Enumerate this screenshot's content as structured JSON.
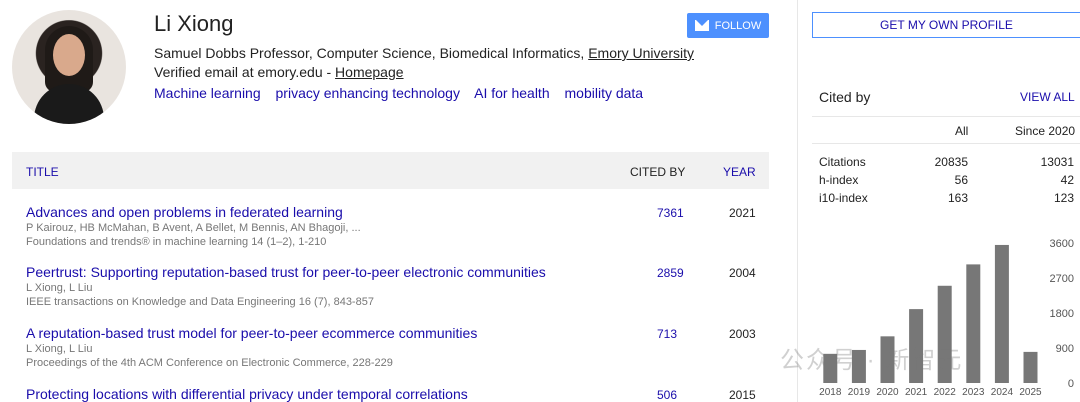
{
  "profile": {
    "name": "Li Xiong",
    "affiliation_prefix": "Samuel Dobbs Professor, Computer Science, Biomedical Informatics, ",
    "affiliation_link": "Emory University",
    "email_text": "Verified email at emory.edu - ",
    "homepage_link": "Homepage",
    "interests": [
      "Machine learning",
      "privacy enhancing technology",
      "AI for health",
      "mobility data"
    ],
    "follow_label": "FOLLOW"
  },
  "table": {
    "headers": {
      "title": "TITLE",
      "cited_by": "CITED BY",
      "year": "YEAR"
    },
    "rows": [
      {
        "title": "Advances and open problems in federated learning",
        "authors": "P Kairouz, HB McMahan, B Avent, A Bellet, M Bennis, AN Bhagoji, ...",
        "venue": "Foundations and trends® in machine learning 14 (1–2), 1-210",
        "cited": "7361",
        "year": "2021"
      },
      {
        "title": "Peertrust: Supporting reputation-based trust for peer-to-peer electronic communities",
        "authors": "L Xiong, L Liu",
        "venue": "IEEE transactions on Knowledge and Data Engineering 16 (7), 843-857",
        "cited": "2859",
        "year": "2004"
      },
      {
        "title": "A reputation-based trust model for peer-to-peer ecommerce communities",
        "authors": "L Xiong, L Liu",
        "venue": "Proceedings of the 4th ACM Conference on Electronic Commerce, 228-229",
        "cited": "713",
        "year": "2003"
      },
      {
        "title": "Protecting locations with differential privacy under temporal correlations",
        "authors": "",
        "venue": "",
        "cited": "506",
        "year": "2015"
      }
    ]
  },
  "sidebar": {
    "get_profile_label": "GET MY OWN PROFILE",
    "cited_by_label": "Cited by",
    "view_all_label": "VIEW ALL",
    "col_all": "All",
    "col_since": "Since 2020",
    "stats": [
      {
        "label": "Citations",
        "all": "20835",
        "since": "13031"
      },
      {
        "label": "h-index",
        "all": "56",
        "since": "42"
      },
      {
        "label": "i10-index",
        "all": "163",
        "since": "123"
      }
    ]
  },
  "watermark": "公众号 · 新智元",
  "chart_data": {
    "type": "bar",
    "categories": [
      "2018",
      "2019",
      "2020",
      "2021",
      "2022",
      "2023",
      "2024",
      "2025"
    ],
    "values": [
      750,
      850,
      1200,
      1900,
      2500,
      3050,
      3550,
      800
    ],
    "ylim": [
      0,
      3600
    ],
    "yticks": [
      "3600",
      "2700",
      "1800",
      "900",
      "0"
    ],
    "bar_color": "#777777"
  }
}
